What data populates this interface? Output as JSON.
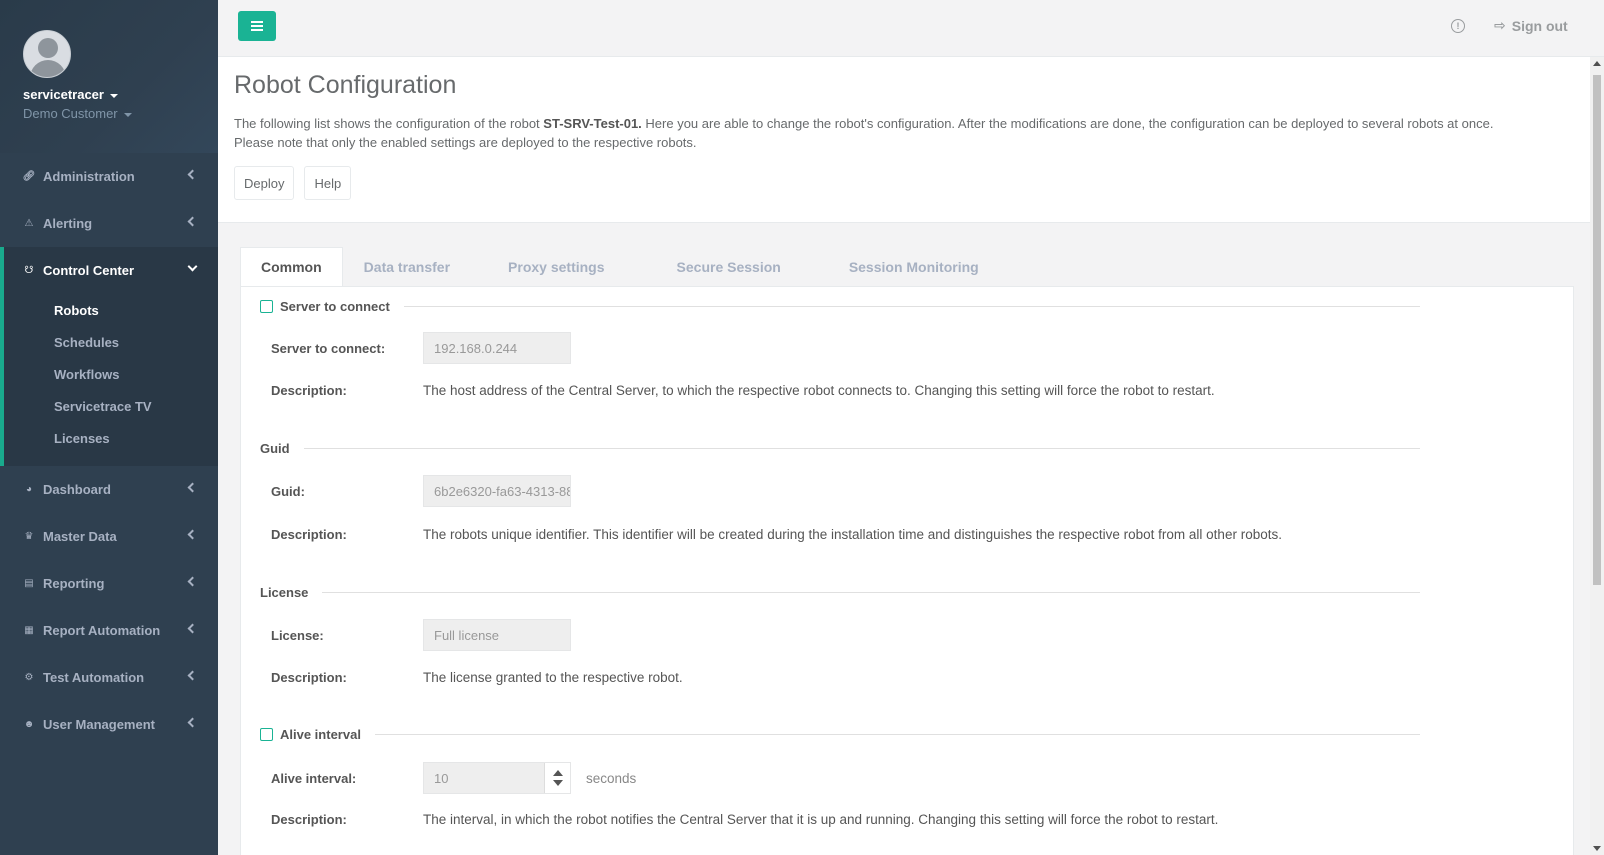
{
  "sidebar": {
    "user_name": "servicetracer",
    "customer": "Demo Customer",
    "items": [
      {
        "label": "Administration",
        "icon": "link-icon"
      },
      {
        "label": "Alerting",
        "icon": "warning-icon"
      },
      {
        "label": "Control Center",
        "icon": "sitemap-icon",
        "expanded": true
      },
      {
        "label": "Dashboard",
        "icon": "pie-chart-icon"
      },
      {
        "label": "Master Data",
        "icon": "crown-icon"
      },
      {
        "label": "Reporting",
        "icon": "list-icon"
      },
      {
        "label": "Report Automation",
        "icon": "report-icon"
      },
      {
        "label": "Test Automation",
        "icon": "gear-icon"
      },
      {
        "label": "User Management",
        "icon": "users-icon"
      }
    ],
    "control_center_sub": [
      "Robots",
      "Schedules",
      "Workflows",
      "Servicetrace TV",
      "Licenses"
    ],
    "active_sub": "Robots"
  },
  "topbar": {
    "signout_label": "Sign out"
  },
  "header": {
    "title": "Robot Configuration",
    "intro_before": "The following list shows the configuration of the robot ",
    "robot_name": "ST-SRV-Test-01.",
    "intro_after": " Here you are able to change the robot's configuration. After the modifications are done, the configuration can be deployed to several robots at once.",
    "intro_line2": "Please note that only the enabled settings are deployed to the respective robots.",
    "deploy_label": "Deploy",
    "help_label": "Help"
  },
  "tabs": [
    "Common",
    "Data transfer",
    "Proxy settings",
    "Secure Session",
    "Session Monitoring"
  ],
  "active_tab": "Common",
  "sections": {
    "server": {
      "legend": "Server to connect",
      "field_label": "Server to connect:",
      "value": "192.168.0.244",
      "desc_label": "Description:",
      "desc": "The host address of the Central Server, to which the respective robot connects to. Changing this setting will force the robot to restart."
    },
    "guid": {
      "legend": "Guid",
      "field_label": "Guid:",
      "value": "6b2e6320-fa63-4313-88",
      "desc_label": "Description:",
      "desc": "The robots unique identifier. This identifier will be created during the installation time and distinguishes the respective robot from all other robots."
    },
    "license": {
      "legend": "License",
      "field_label": "License:",
      "value": "Full license",
      "desc_label": "Description:",
      "desc": "The license granted to the respective robot."
    },
    "alive": {
      "legend": "Alive interval",
      "field_label": "Alive interval:",
      "value": "10",
      "unit": "seconds",
      "desc_label": "Description:",
      "desc": "The interval, in which the robot notifies the Central Server that it is up and running. Changing this setting will force the robot to restart."
    }
  },
  "colors": {
    "sidebar_bg": "#2f4050",
    "accent": "#1ab394"
  }
}
